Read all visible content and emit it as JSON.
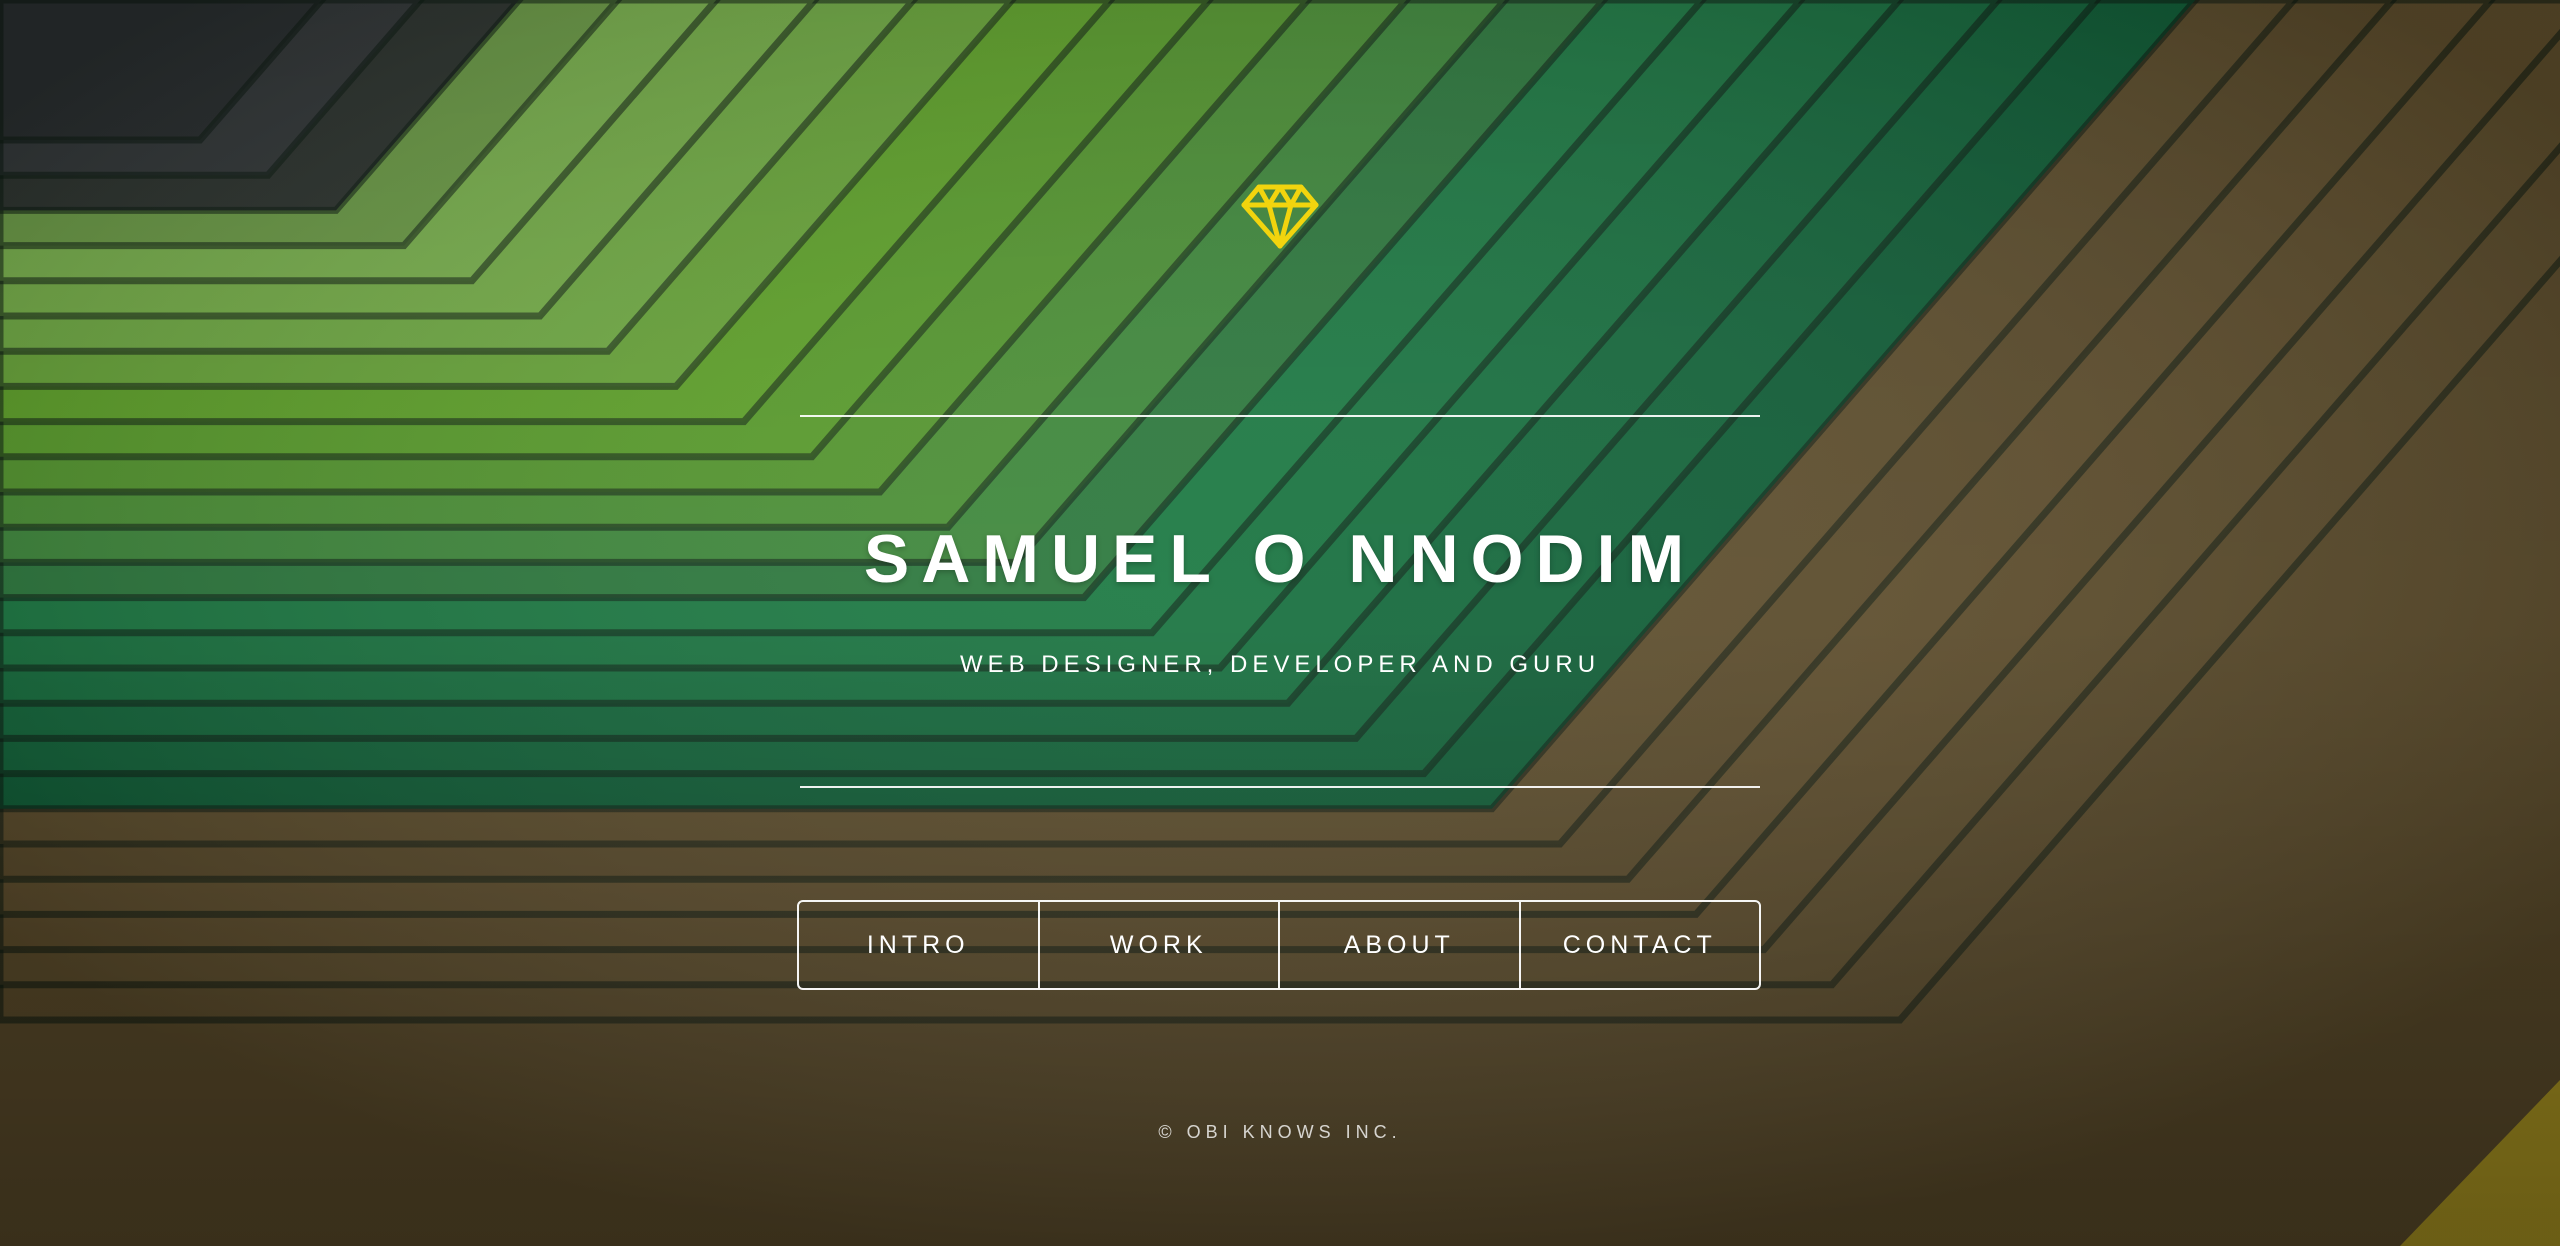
{
  "hero": {
    "logo_icon": "diamond-icon",
    "logo_color": "#f2d40e",
    "title": "SAMUEL O NNODIM",
    "subtitle": "WEB DESIGNER, DEVELOPER AND GURU"
  },
  "nav": {
    "items": [
      {
        "label": "INTRO"
      },
      {
        "label": "WORK"
      },
      {
        "label": "ABOUT"
      },
      {
        "label": "CONTACT"
      }
    ]
  },
  "footer": {
    "copyright": "© OBI KNOWS INC."
  },
  "colors": {
    "text": "#ffffff",
    "accent": "#f2d40e",
    "background_green": "#1e6a3c",
    "background_lime": "#5aa82a",
    "background_brown": "#5e4e2c"
  }
}
